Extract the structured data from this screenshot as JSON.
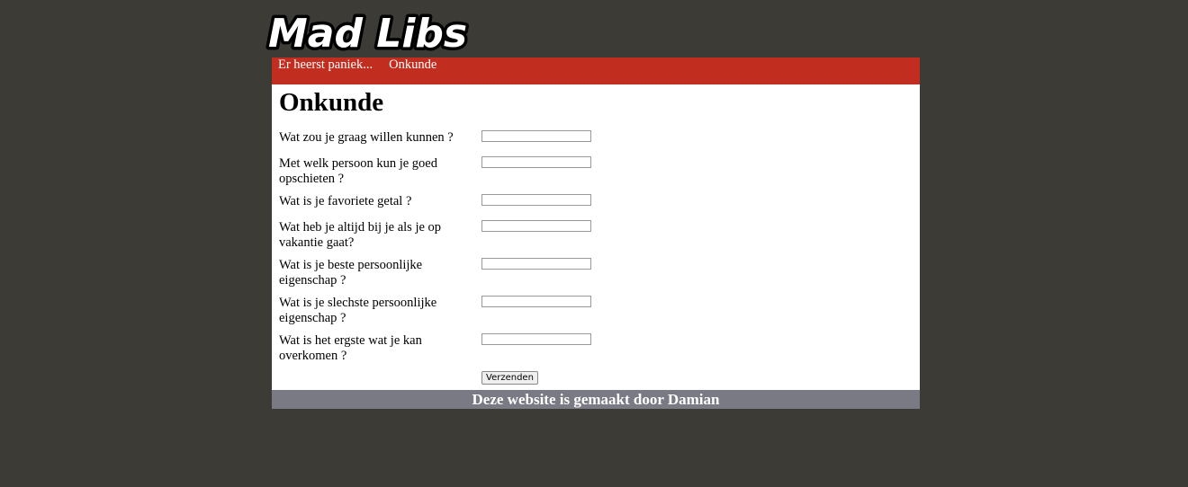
{
  "logo": {
    "text": "Mad Libs"
  },
  "nav": {
    "items": [
      {
        "label": "Er heerst paniek..."
      },
      {
        "label": "Onkunde"
      }
    ]
  },
  "page": {
    "title": "Onkunde"
  },
  "form": {
    "questions": [
      {
        "label": "Wat zou je graag willen kunnen ?",
        "value": ""
      },
      {
        "label": "Met welk persoon kun je goed opschieten ?",
        "value": ""
      },
      {
        "label": "Wat is je favoriete getal ?",
        "value": ""
      },
      {
        "label": "Wat heb je altijd bij je als je op vakantie gaat?",
        "value": ""
      },
      {
        "label": "Wat is je beste persoonlijke eigenschap ?",
        "value": ""
      },
      {
        "label": "Wat is je slechste persoonlijke eigenschap ?",
        "value": ""
      },
      {
        "label": "Wat is het ergste wat je kan overkomen ?",
        "value": ""
      }
    ],
    "submit_label": "Verzenden"
  },
  "footer": {
    "text": "Deze website is gemaakt door Damian"
  }
}
